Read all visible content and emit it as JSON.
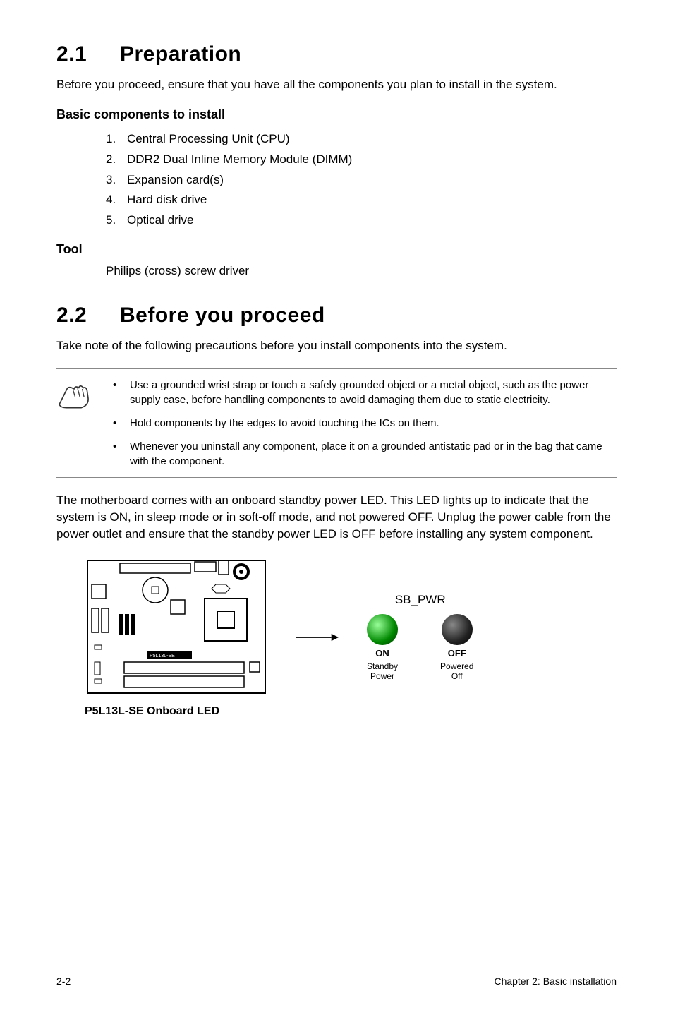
{
  "section1": {
    "num": "2.1",
    "title": "Preparation",
    "intro": "Before you proceed, ensure that you have all the components you plan to install in the system.",
    "basic_heading": "Basic components to install",
    "items": [
      "Central Processing Unit (CPU)",
      "DDR2 Dual Inline Memory Module (DIMM)",
      "Expansion card(s)",
      "Hard disk drive",
      "Optical drive"
    ],
    "tool_heading": "Tool",
    "tool_text": "Philips (cross) screw driver"
  },
  "section2": {
    "num": "2.2",
    "title": "Before you proceed",
    "intro": "Take note of the following precautions before you install components into the system.",
    "notes": [
      "Use a grounded wrist strap or touch a safely grounded object or a metal object, such as the power supply case, before handling components to avoid damaging them due to static electricity.",
      "Hold components by the edges to avoid touching the ICs on them.",
      "Whenever you uninstall any component, place it on a grounded antistatic pad or in the bag that came with the component."
    ],
    "body": "The motherboard comes with an onboard standby power LED. This LED lights up to indicate that the system is ON, in sleep mode or in soft-off mode, and not powered OFF. Unplug the power cable from the power outlet and ensure that the standby power LED is OFF before installing any system component."
  },
  "diagram": {
    "sb_pwr": "SB_PWR",
    "on": "ON",
    "on_sub": "Standby\nPower",
    "off": "OFF",
    "off_sub": "Powered\nOff",
    "caption": "P5L13L-SE Onboard LED",
    "board_label": "P5L13L-SE"
  },
  "footer": {
    "page": "2-2",
    "chapter": "Chapter 2: Basic installation"
  }
}
